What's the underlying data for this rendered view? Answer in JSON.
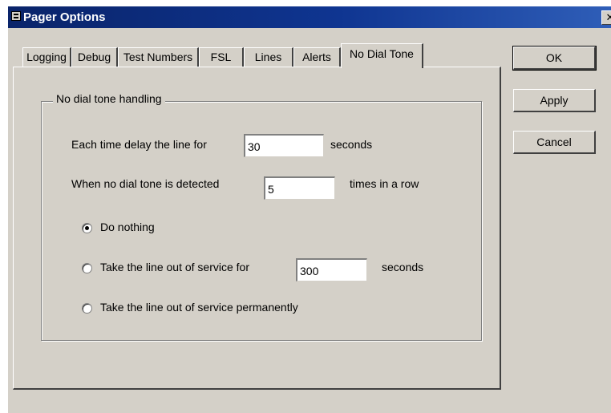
{
  "window": {
    "title": "Pager Options",
    "close_glyph": "✕"
  },
  "tabs": [
    {
      "label": "Logging"
    },
    {
      "label": "Debug"
    },
    {
      "label": "Test Numbers"
    },
    {
      "label": "FSL"
    },
    {
      "label": "Lines"
    },
    {
      "label": "Alerts"
    },
    {
      "label": "No Dial Tone",
      "active": true
    }
  ],
  "group": {
    "title": "No dial tone handling",
    "delay_prefix": "Each time delay the line for",
    "delay_value": "30",
    "delay_suffix": "seconds",
    "detect_prefix": "When no dial tone is detected",
    "detect_value": "5",
    "detect_suffix": "times in a row",
    "options": [
      {
        "label": "Do nothing",
        "checked": true
      },
      {
        "label": "Take the line out of service for",
        "value": "300",
        "suffix": "seconds",
        "checked": false
      },
      {
        "label": "Take the line out of service permanently",
        "checked": false
      }
    ]
  },
  "buttons": {
    "ok": "OK",
    "apply": "Apply",
    "cancel": "Cancel"
  },
  "icons": {
    "title": "pager-options-icon",
    "close": "close-icon"
  }
}
